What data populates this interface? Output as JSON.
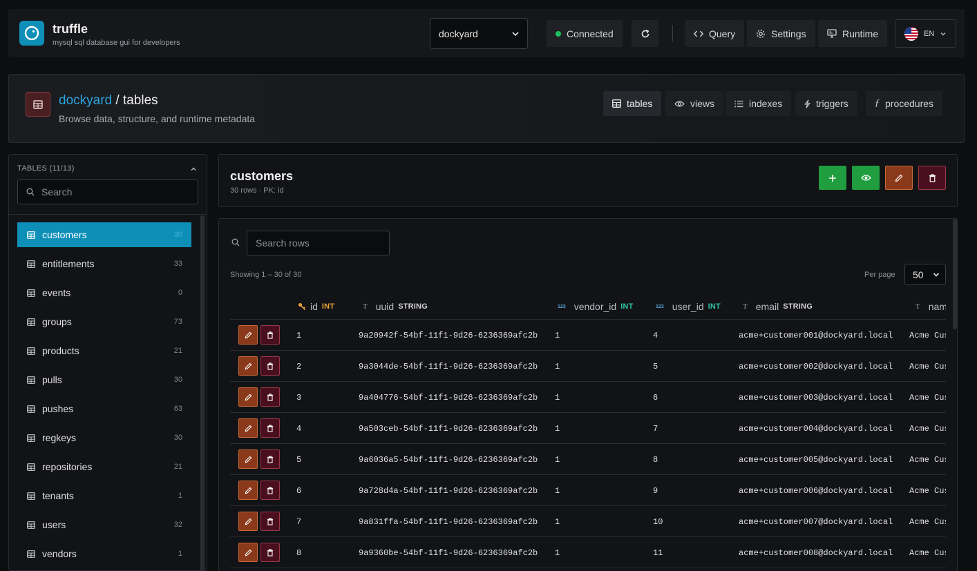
{
  "app": {
    "name": "truffle",
    "tagline": "mysql sql database gui for developers"
  },
  "topbar": {
    "database": "dockyard",
    "status": "Connected",
    "nav": {
      "query": "Query",
      "settings": "Settings",
      "runtime": "Runtime"
    },
    "language": "EN"
  },
  "header": {
    "db_link": "dockyard",
    "sep": " / ",
    "section": "tables",
    "subtitle": "Browse data, structure, and runtime metadata",
    "tabs": {
      "tables": "tables",
      "views": "views",
      "indexes": "indexes",
      "triggers": "triggers",
      "procedures": "procedures"
    }
  },
  "sidebar": {
    "title": "TABLES (11/13)",
    "search_placeholder": "Search",
    "items": [
      {
        "name": "customers",
        "count": "30"
      },
      {
        "name": "entitlements",
        "count": "33"
      },
      {
        "name": "events",
        "count": "0"
      },
      {
        "name": "groups",
        "count": "73"
      },
      {
        "name": "products",
        "count": "21"
      },
      {
        "name": "pulls",
        "count": "30"
      },
      {
        "name": "pushes",
        "count": "63"
      },
      {
        "name": "regkeys",
        "count": "30"
      },
      {
        "name": "repositories",
        "count": "21"
      },
      {
        "name": "tenants",
        "count": "1"
      },
      {
        "name": "users",
        "count": "32"
      },
      {
        "name": "vendors",
        "count": "1"
      }
    ]
  },
  "table": {
    "name": "customers",
    "meta": "30 rows · PK: id",
    "search_placeholder": "Search rows",
    "showing": "Showing 1 – 30 of 30",
    "per_page_label": "Per page",
    "per_page": "50",
    "columns": [
      {
        "name": "id",
        "type": "INT"
      },
      {
        "name": "uuid",
        "type": "STRING"
      },
      {
        "name": "vendor_id",
        "type": "INT"
      },
      {
        "name": "user_id",
        "type": "INT"
      },
      {
        "name": "email",
        "type": "STRING"
      },
      {
        "name": "nam",
        "type": ""
      }
    ],
    "rows": [
      {
        "id": "1",
        "uuid": "9a20942f-54bf-11f1-9d26-6236369afc2b",
        "vendor_id": "1",
        "user_id": "4",
        "email": "acme+customer001@dockyard.local",
        "name": "Acme Cus"
      },
      {
        "id": "2",
        "uuid": "9a3044de-54bf-11f1-9d26-6236369afc2b",
        "vendor_id": "1",
        "user_id": "5",
        "email": "acme+customer002@dockyard.local",
        "name": "Acme Cus"
      },
      {
        "id": "3",
        "uuid": "9a404776-54bf-11f1-9d26-6236369afc2b",
        "vendor_id": "1",
        "user_id": "6",
        "email": "acme+customer003@dockyard.local",
        "name": "Acme Cus"
      },
      {
        "id": "4",
        "uuid": "9a503ceb-54bf-11f1-9d26-6236369afc2b",
        "vendor_id": "1",
        "user_id": "7",
        "email": "acme+customer004@dockyard.local",
        "name": "Acme Cus"
      },
      {
        "id": "5",
        "uuid": "9a6036a5-54bf-11f1-9d26-6236369afc2b",
        "vendor_id": "1",
        "user_id": "8",
        "email": "acme+customer005@dockyard.local",
        "name": "Acme Cus"
      },
      {
        "id": "6",
        "uuid": "9a728d4a-54bf-11f1-9d26-6236369afc2b",
        "vendor_id": "1",
        "user_id": "9",
        "email": "acme+customer006@dockyard.local",
        "name": "Acme Cus"
      },
      {
        "id": "7",
        "uuid": "9a831ffa-54bf-11f1-9d26-6236369afc2b",
        "vendor_id": "1",
        "user_id": "10",
        "email": "acme+customer007@dockyard.local",
        "name": "Acme Cus"
      },
      {
        "id": "8",
        "uuid": "9a9360be-54bf-11f1-9d26-6236369afc2b",
        "vendor_id": "1",
        "user_id": "11",
        "email": "acme+customer008@dockyard.local",
        "name": "Acme Cus"
      }
    ]
  },
  "colors": {
    "accent": "#0e8fb8",
    "connected": "#1fbf5f",
    "add": "#1f9d3f",
    "view": "#1f9d3f",
    "edit": "#8a3a1a",
    "delete": "#4a0f1f"
  }
}
